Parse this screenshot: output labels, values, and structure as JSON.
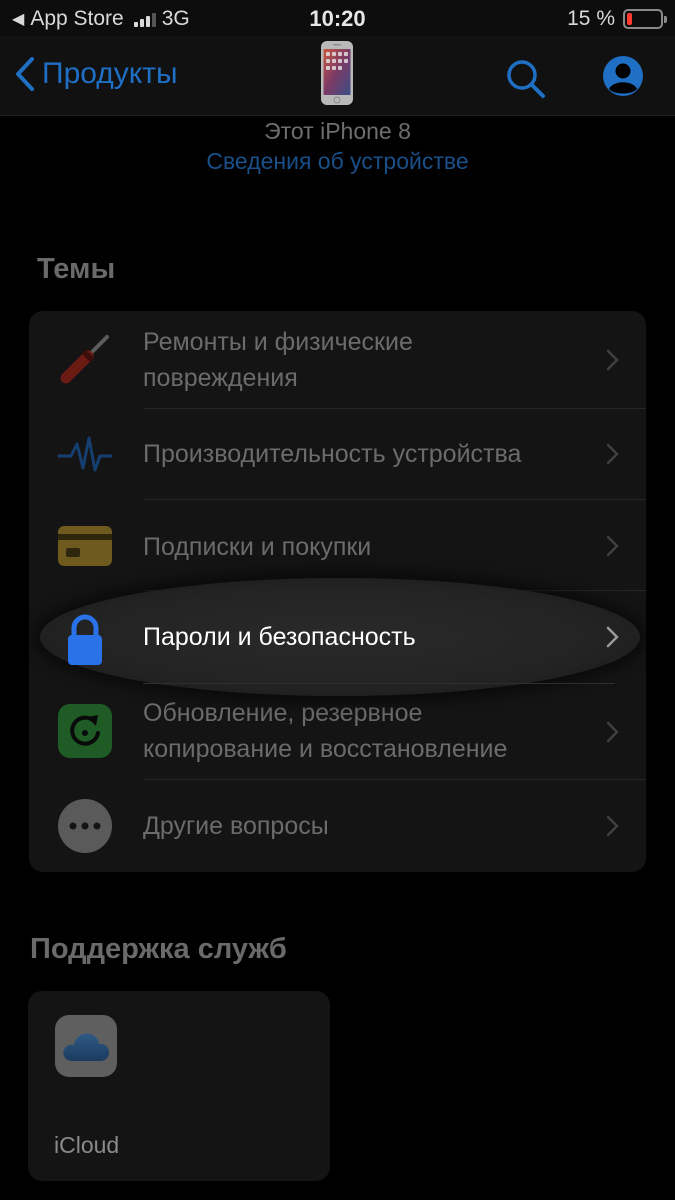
{
  "status_bar": {
    "back_app": "App Store",
    "network": "3G",
    "time": "10:20",
    "battery_percent": "15 %",
    "battery_level": 0.15,
    "signal_bars": 3
  },
  "nav": {
    "back_label": "Продукты",
    "device_icon": "iphone-icon",
    "search_icon": "search-icon",
    "account_icon": "account-icon"
  },
  "device": {
    "name": "Этот iPhone 8",
    "details_link": "Сведения об устройстве"
  },
  "topics": {
    "title": "Темы",
    "items": [
      {
        "label": "Ремонты и физические повреждения",
        "icon": "screwdriver-icon"
      },
      {
        "label": "Производительность устройства",
        "icon": "pulse-icon"
      },
      {
        "label": "Подписки и покупки",
        "icon": "credit-card-icon"
      },
      {
        "label": "Пароли и безопасность",
        "icon": "lock-icon"
      },
      {
        "label": "Обновление, резервное копирование и восстановление",
        "icon": "restore-icon"
      },
      {
        "label": "Другие вопросы",
        "icon": "more-icon"
      }
    ]
  },
  "services": {
    "title": "Поддержка служб",
    "items": [
      {
        "label": "iCloud",
        "icon": "icloud-icon"
      }
    ]
  },
  "colors": {
    "accent": "#1f6fc4",
    "background": "#000000",
    "card": "#141414",
    "battery_low": "#ff3b30"
  }
}
